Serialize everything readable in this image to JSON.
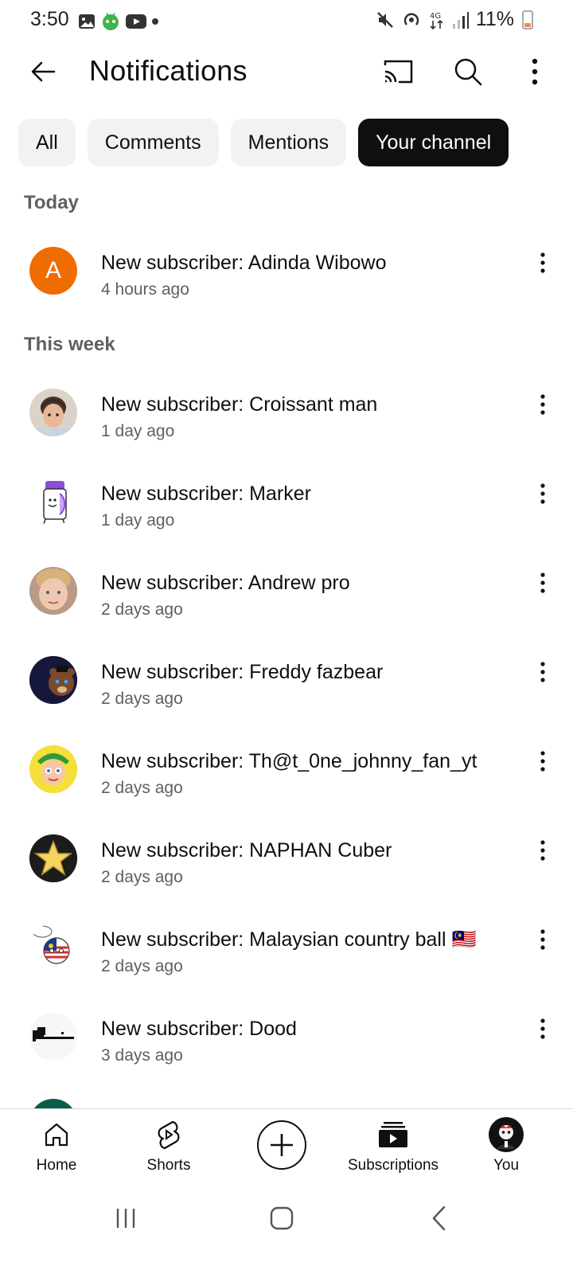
{
  "status_bar": {
    "time": "3:50",
    "battery_percent": "11%"
  },
  "app_bar": {
    "title": "Notifications"
  },
  "chips": [
    {
      "label": "All",
      "active": false
    },
    {
      "label": "Comments",
      "active": false
    },
    {
      "label": "Mentions",
      "active": false
    },
    {
      "label": "Your channel",
      "active": true
    }
  ],
  "sections": {
    "today": "Today",
    "this_week": "This week"
  },
  "notifications": [
    {
      "title": "New subscriber: Adinda Wibowo",
      "time": "4 hours ago",
      "avatar_letter": "A",
      "avatar_color": "#ef6c00",
      "avatar_icon": "letter-avatar"
    },
    {
      "title": "New subscriber: Croissant man",
      "time": "1 day ago",
      "avatar_icon": "photo-avatar-kid"
    },
    {
      "title": "New subscriber: Marker",
      "time": "1 day ago",
      "avatar_icon": "marker-character-avatar"
    },
    {
      "title": "New subscriber: Andrew pro",
      "time": "2 days ago",
      "avatar_icon": "photo-avatar-face"
    },
    {
      "title": "New subscriber: Freddy fazbear",
      "time": "2 days ago",
      "avatar_icon": "freddy-avatar"
    },
    {
      "title": "New subscriber: Th@t_0ne_johnny_fan_yt",
      "time": "2 days ago",
      "avatar_icon": "cartoon-avatar"
    },
    {
      "title": "New subscriber: NAPHAN Cuber",
      "time": "2 days ago",
      "avatar_icon": "star-avatar"
    },
    {
      "title": "New subscriber: Malaysian country ball 🇲🇾",
      "time": "2 days ago",
      "avatar_icon": "countryball-avatar"
    },
    {
      "title": "New subscriber: Dood",
      "time": "3 days ago",
      "avatar_icon": "dood-avatar"
    }
  ],
  "bottom_nav": {
    "home": "Home",
    "shorts": "Shorts",
    "subscriptions": "Subscriptions",
    "you": "You"
  },
  "colors": {
    "chip_active_bg": "#0f0f0f",
    "chip_bg": "#f2f2f2",
    "secondary_text": "#606060"
  }
}
